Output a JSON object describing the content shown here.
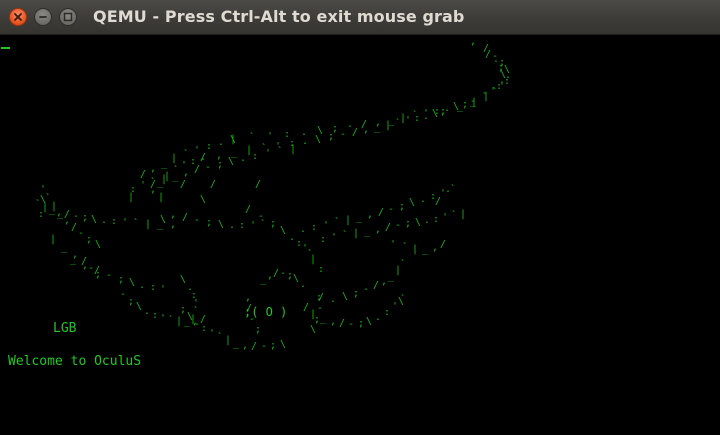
{
  "window": {
    "title": "QEMU - Press Ctrl-Alt to exit mouse grab",
    "controls": [
      {
        "name": "close",
        "icon": "close-icon"
      },
      {
        "name": "minimize",
        "icon": "minimize-icon"
      },
      {
        "name": "maximize",
        "icon": "maximize-icon"
      }
    ]
  },
  "terminal": {
    "lines": [
      "LGB",
      "Welcome to OculuS"
    ],
    "eye_center": ";( O )",
    "text_color": "#22c722",
    "background": "#000000"
  },
  "art": {
    "glyph_chars": [
      "`",
      ".",
      "-",
      "_",
      "'",
      "\\",
      "/",
      "|",
      ":",
      ";",
      ","
    ]
  }
}
